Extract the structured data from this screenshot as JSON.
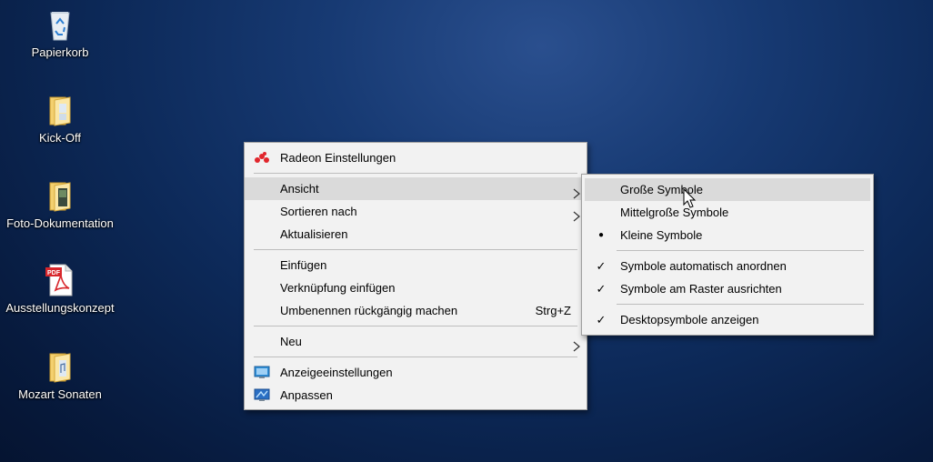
{
  "desktop": {
    "icons": [
      {
        "label": "Papierkorb",
        "icon": "recycle-bin-icon"
      },
      {
        "label": "Kick-Off",
        "icon": "folder-icon"
      },
      {
        "label": "Foto-Dokumentation",
        "icon": "folder-icon"
      },
      {
        "label": "Ausstellungskonzept",
        "icon": "pdf-icon"
      },
      {
        "label": "Mozart Sonaten",
        "icon": "folder-icon"
      }
    ],
    "pdf_badge": "PDF"
  },
  "context_menu": {
    "radeon": "Radeon Einstellungen",
    "ansicht": "Ansicht",
    "sortieren": "Sortieren nach",
    "aktualisieren": "Aktualisieren",
    "einfuegen": "Einfügen",
    "verknuepfung": "Verknüpfung einfügen",
    "umbenennen": "Umbenennen rückgängig machen",
    "umbenennen_shortcut": "Strg+Z",
    "neu": "Neu",
    "anzeige": "Anzeigeeinstellungen",
    "anpassen": "Anpassen"
  },
  "submenu_ansicht": {
    "gross": "Große Symbole",
    "mittel": "Mittelgroße Symbole",
    "klein": "Kleine Symbole",
    "auto_anordnen": "Symbole automatisch anordnen",
    "raster": "Symbole am Raster ausrichten",
    "desktopsymbole": "Desktopsymbole anzeigen",
    "bullet": "●",
    "check": "✓"
  },
  "colors": {
    "menu_bg": "#f2f2f2",
    "hover": "#dadada",
    "radeon_red": "#e1262c"
  }
}
